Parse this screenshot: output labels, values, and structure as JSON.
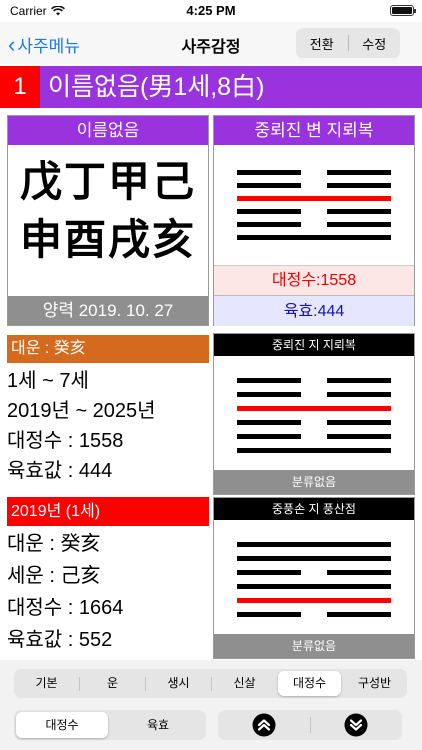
{
  "status": {
    "carrier": "Carrier",
    "time": "4:25 PM"
  },
  "nav": {
    "back_label": "사주메뉴",
    "title": "사주감정",
    "switch_label": "전환",
    "edit_label": "수정"
  },
  "header": {
    "number": "1",
    "name": "이름없음(男1세,8白)"
  },
  "saju": {
    "title": "이름없음",
    "top_chars": "戊丁甲己",
    "bottom_chars": "申酉戌亥",
    "date": "양력 2019. 10. 27"
  },
  "daewoon": {
    "heading": "대운 : 癸亥",
    "lines": [
      "1세 ~ 7세",
      "2019년 ~ 2025년",
      "대정수 : 1558",
      "육효값 : 444"
    ]
  },
  "year": {
    "heading": "2019년 (1세)",
    "lines": [
      "대운 : 癸亥",
      "세운 : 己亥",
      "대정수 : 1664",
      "육효값 : 552"
    ]
  },
  "hex_main": {
    "title": "중뢰진 변 지뢰복",
    "daejeong": "대정수:1558",
    "yukhyo": "육효:444",
    "lines": [
      "broken",
      "broken",
      "solid-red",
      "broken",
      "broken",
      "solid"
    ]
  },
  "hex_2": {
    "title": "중뢰진 지 지뢰복",
    "footer": "분류없음",
    "lines": [
      "broken",
      "broken",
      "solid-red",
      "broken",
      "broken",
      "solid"
    ]
  },
  "hex_3": {
    "title": "중풍손 지 풍산점",
    "footer": "분류없음",
    "lines": [
      "solid",
      "solid",
      "broken",
      "solid",
      "solid-red",
      "broken"
    ]
  },
  "tabs": {
    "items": [
      "기본",
      "운",
      "생시",
      "신살",
      "대정수",
      "구성반"
    ],
    "active_index": 4
  },
  "mode": {
    "items": [
      "대정수",
      "육효"
    ],
    "active_index": 0
  },
  "arrows": {
    "up_icon": "double-chevron-up-icon",
    "down_icon": "double-chevron-down-icon"
  },
  "colors": {
    "purple": "#9933dd",
    "red": "#ff0000",
    "orange": "#d46a1e",
    "blue": "#1478f5"
  }
}
